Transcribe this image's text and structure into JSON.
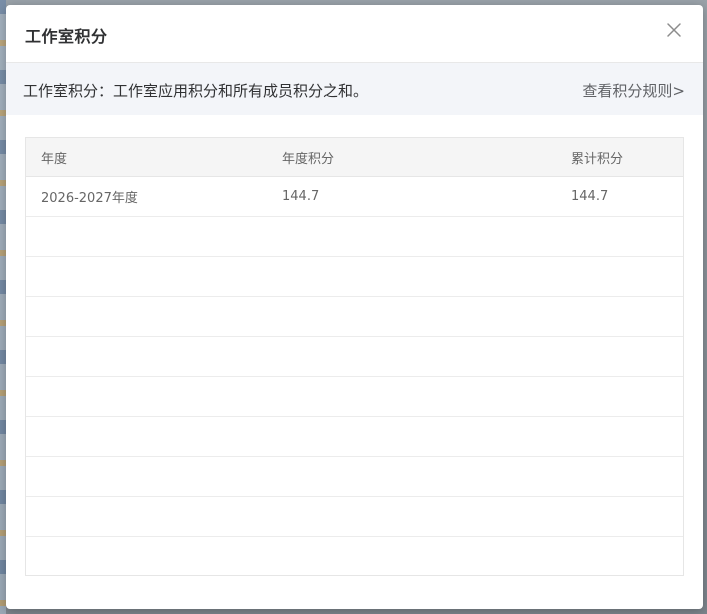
{
  "dialog": {
    "title": "工作室积分",
    "close_icon": "close-icon"
  },
  "info": {
    "text": "工作室积分：工作室应用积分和所有成员积分之和。",
    "rules_link": "查看积分规则>"
  },
  "table": {
    "headers": [
      "年度",
      "年度积分",
      "累计积分"
    ],
    "rows": [
      [
        "2026-2027年度",
        "144.7",
        "144.7"
      ]
    ]
  }
}
